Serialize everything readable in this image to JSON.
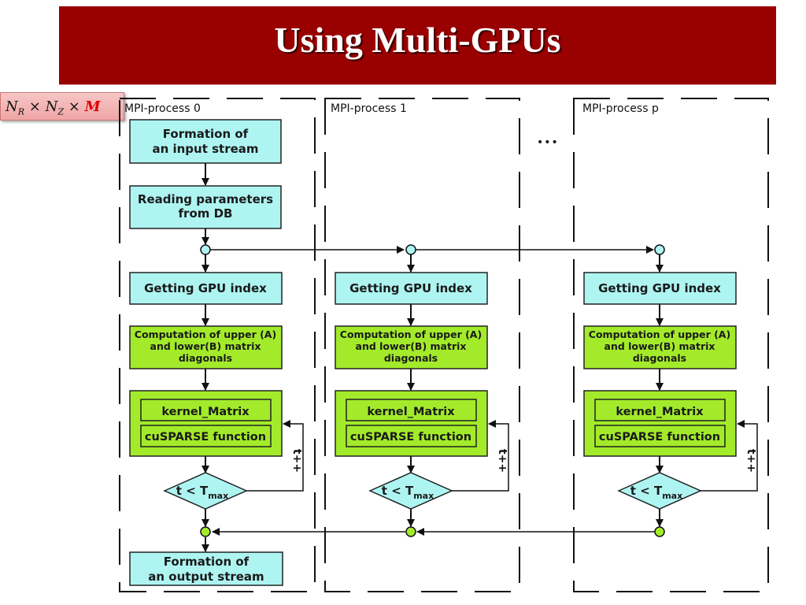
{
  "slide": {
    "title": "Using Multi-GPUs",
    "formula": {
      "n_r": "N",
      "sub_r": "R",
      "n_z": "N",
      "sub_z": "Z",
      "times": "×",
      "m": "M"
    }
  },
  "colors": {
    "title_bg": "#990000",
    "cyan_box": "#aef5f2",
    "green_box": "#a3eb2a",
    "formula_bg": "#f2b3b3",
    "formula_accent": "#e00000"
  },
  "ellipsis": "•••",
  "processes": [
    {
      "label": "MPI-process 0",
      "input_stream": [
        "Formation of",
        "an input stream"
      ],
      "read_params": [
        "Reading parameters",
        "from DB"
      ],
      "gpu_index": "Getting GPU index",
      "computation": [
        "Computation of upper (A)",
        "and lower(B) matrix",
        "diagonals"
      ],
      "kernel": "kernel_Matrix",
      "cusparse": "cuSPARSE function",
      "condition": {
        "t": "t < T",
        "sub": "max"
      },
      "loop_label": "t++",
      "output_stream": [
        "Formation of",
        "an output stream"
      ]
    },
    {
      "label": "MPI-process 1",
      "gpu_index": "Getting GPU index",
      "computation": [
        "Computation of upper (A)",
        "and lower(B) matrix",
        "diagonals"
      ],
      "kernel": "kernel_Matrix",
      "cusparse": "cuSPARSE function",
      "condition": {
        "t": "t < T",
        "sub": "max"
      },
      "loop_label": "t++"
    },
    {
      "label": "MPI-process p",
      "gpu_index": "Getting GPU index",
      "computation": [
        "Computation of upper (A)",
        "and lower(B) matrix",
        "diagonals"
      ],
      "kernel": "kernel_Matrix",
      "cusparse": "cuSPARSE function",
      "condition": {
        "t": "t < T",
        "sub": "max"
      },
      "loop_label": "t++"
    }
  ]
}
